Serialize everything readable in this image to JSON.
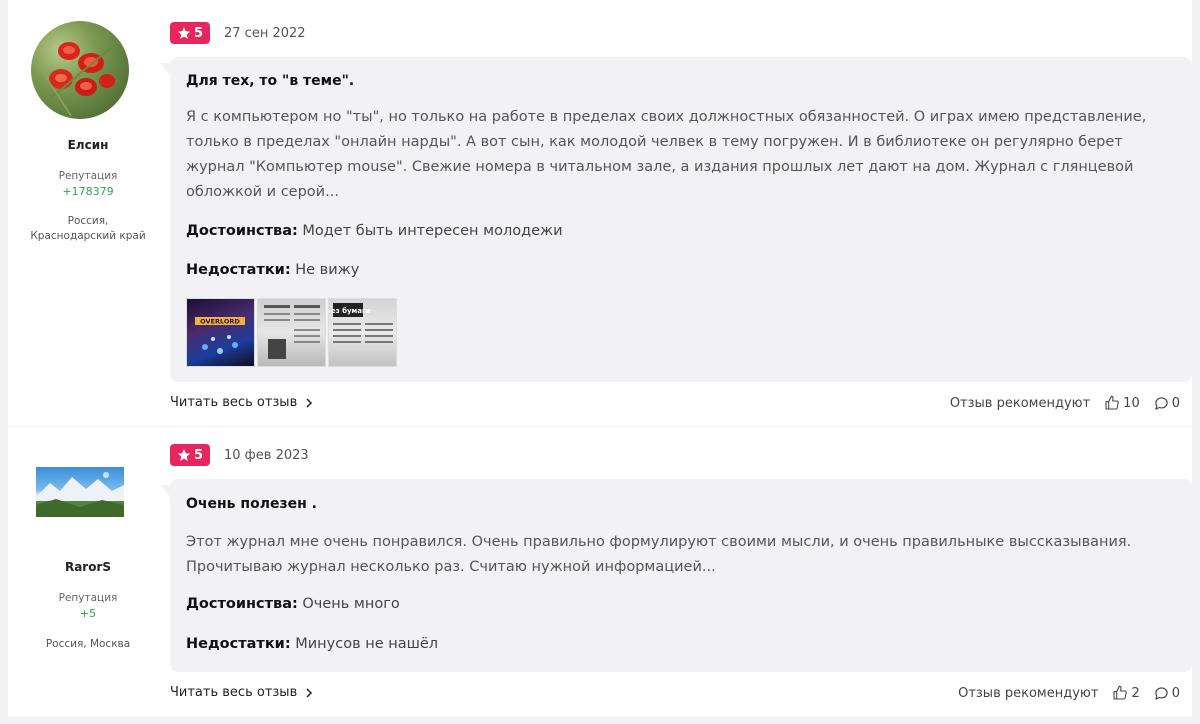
{
  "reviews": [
    {
      "author": {
        "name": "Елсин",
        "reputation_label": "Репутация",
        "reputation_value": "+178379",
        "location": "Россия, Краснодарский край",
        "avatar": "mushroom-photo"
      },
      "rating": "5",
      "date": "27 сен 2022",
      "title": "Для тех, то \"в теме\".",
      "text": "Я с компьютером но \"ты\", но только на работе в пределах своих должностных обязанностей. О играх имею представление, только в пределах \"онлайн нарды\". А вот сын, как молодой челвек в тему погружен. И в библиотеке он регулярно берет журнал \"Компьютер mouse\". Свежие номера в читальном зале, а издания прошлых лет дают на дом. Журнал с глянцевой обложкой и серой...",
      "pros_label": "Достоинства:",
      "pros": "Модет быть интересен молодежи",
      "cons_label": "Недостатки:",
      "cons": "Не вижу",
      "photos": [
        "magazine-cover-overlord",
        "magazine-page",
        "magazine-page-bez-bumagi"
      ],
      "photo_text": {
        "cover": "OVERLORD",
        "page3": "Без бумаги"
      },
      "read_more": "Читать весь отзыв",
      "recommend_label": "Отзыв рекомендуют",
      "likes": "10",
      "comments": "0"
    },
    {
      "author": {
        "name": "RarorS",
        "reputation_label": "Репутация",
        "reputation_value": "+5",
        "location": "Россия, Москва",
        "avatar": "mountain-landscape-photo"
      },
      "rating": "5",
      "date": "10 фев 2023",
      "title": "Очень полезен .",
      "text": "Этот журнал мне очень понравился. Очень правильно формулируют своими мысли, и очень правильныке выссказывания. Прочитываю журнал несколько раз. Считаю нужной информацией...",
      "pros_label": "Достоинства:",
      "pros": "Очень много",
      "cons_label": "Недостатки:",
      "cons": "Минусов не нашёл",
      "read_more": "Читать весь отзыв",
      "recommend_label": "Отзыв рекомендуют",
      "likes": "2",
      "comments": "0"
    }
  ],
  "colors": {
    "rating_badge": "#e8265e",
    "reputation": "#2ea44f",
    "bubble_bg": "#f2f2f4"
  },
  "icons": {
    "star": "star-icon",
    "chevron": "chevron-right-icon",
    "like": "thumbs-up-icon",
    "comment": "comment-icon"
  }
}
